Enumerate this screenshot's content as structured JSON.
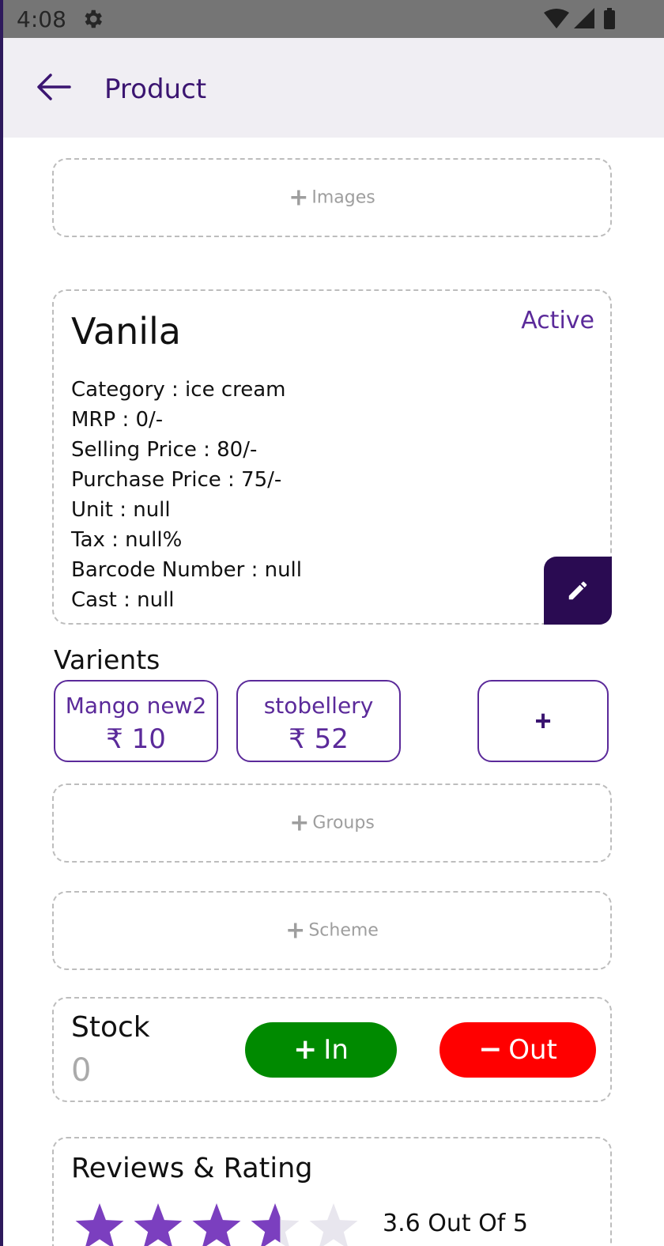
{
  "status_bar": {
    "time": "4:08",
    "icons": [
      "gear-icon",
      "wifi-icon",
      "signal-icon",
      "battery-icon"
    ]
  },
  "app_bar": {
    "back_icon": "arrow-left-icon",
    "title": "Product"
  },
  "images_box": {
    "label": "Images",
    "icon": "plus-icon"
  },
  "product": {
    "name": "Vanila",
    "status": "Active",
    "details": [
      "Category : ice cream",
      "MRP : 0/-",
      "Selling Price : 80/-",
      "Purchase Price : 75/-",
      "Unit : null",
      "Tax : null%",
      "Barcode Number : null",
      "Cast : null"
    ],
    "edit_icon": "pencil-icon"
  },
  "variants": {
    "title": "Varients",
    "items": [
      {
        "name": "Mango new2",
        "price": "₹ 10"
      },
      {
        "name": "stobellery",
        "price": "₹ 52"
      }
    ],
    "add_label": "+"
  },
  "groups_box": {
    "label": "Groups",
    "icon": "plus-icon"
  },
  "scheme_box": {
    "label": "Scheme",
    "icon": "plus-icon"
  },
  "stock": {
    "title": "Stock",
    "value": "0",
    "in_label": "In",
    "out_label": "Out",
    "in_color": "#008a00",
    "out_color": "#ff0000"
  },
  "reviews": {
    "title": "Reviews & Rating",
    "rating": 3.6,
    "max": 5,
    "rating_text": "3.6 Out Of 5",
    "star_color": "#7b3fbf",
    "empty_star_color": "#e8e6ee"
  },
  "colors": {
    "accent": "#5b2a9a",
    "app_bar_bg": "#f0eef3",
    "edit_button_bg": "#2a0b52"
  }
}
